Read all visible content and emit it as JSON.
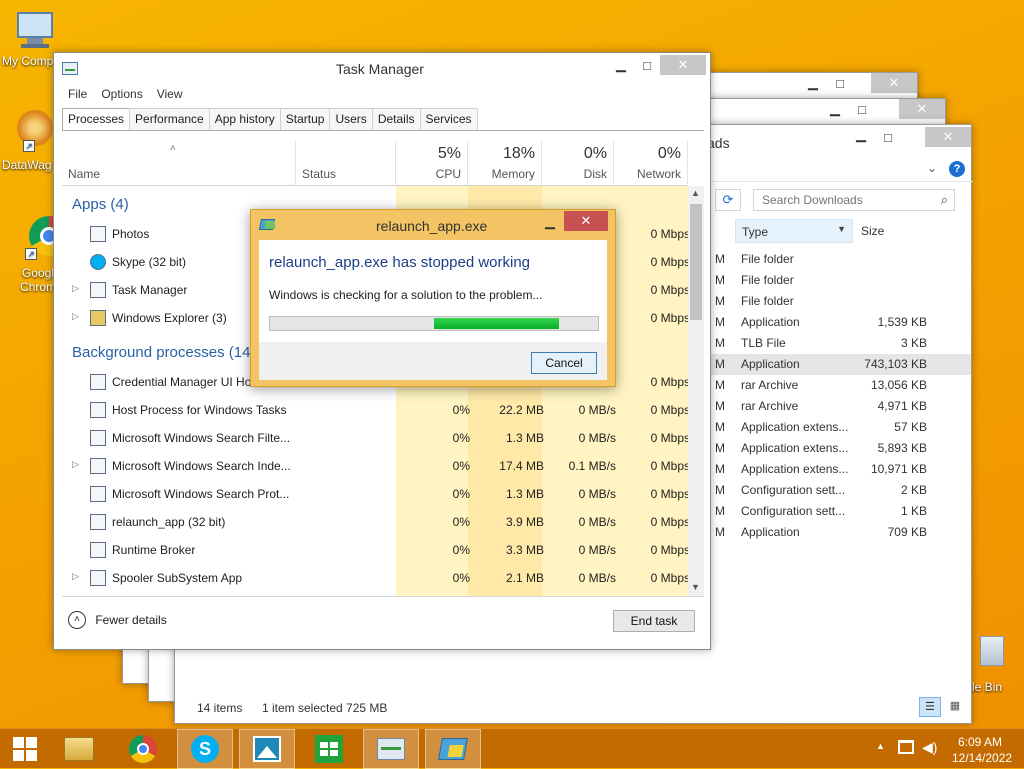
{
  "desktop": {
    "icons": [
      {
        "label": "My Comp",
        "icon": "computer-icon"
      },
      {
        "label": "DataWag",
        "icon": "datawag-icon"
      },
      {
        "label": "Googl Chrom",
        "icon": "chrome-icon"
      },
      {
        "label": "cle Bin",
        "icon": "recycle-bin-icon"
      }
    ]
  },
  "explorer": {
    "title_fragment": "ads",
    "search_placeholder": "Search Downloads",
    "columns": {
      "type": "Type",
      "size": "Size"
    },
    "rows": [
      {
        "prefix": "M",
        "type": "File folder",
        "size": ""
      },
      {
        "prefix": "M",
        "type": "File folder",
        "size": ""
      },
      {
        "prefix": "M",
        "type": "File folder",
        "size": ""
      },
      {
        "prefix": "M",
        "type": "Application",
        "size": "1,539 KB"
      },
      {
        "prefix": "M",
        "type": "TLB File",
        "size": "3 KB"
      },
      {
        "prefix": "M",
        "type": "Application",
        "size": "743,103 KB"
      },
      {
        "prefix": "M",
        "type": "rar Archive",
        "size": "13,056 KB"
      },
      {
        "prefix": "M",
        "type": "rar Archive",
        "size": "4,971 KB"
      },
      {
        "prefix": "M",
        "type": "Application extens...",
        "size": "57 KB"
      },
      {
        "prefix": "M",
        "type": "Application extens...",
        "size": "5,893 KB"
      },
      {
        "prefix": "M",
        "type": "Application extens...",
        "size": "10,971 KB"
      },
      {
        "prefix": "M",
        "type": "Configuration sett...",
        "size": "2 KB"
      },
      {
        "prefix": "M",
        "type": "Configuration sett...",
        "size": "1 KB"
      },
      {
        "prefix": "M",
        "type": "Application",
        "size": "709 KB"
      }
    ],
    "status_items": "14 items",
    "status_selected": "1 item selected  725 MB"
  },
  "task_manager": {
    "title": "Task Manager",
    "menu": [
      "File",
      "Options",
      "View"
    ],
    "tabs": [
      "Processes",
      "Performance",
      "App history",
      "Startup",
      "Users",
      "Details",
      "Services"
    ],
    "columns": {
      "name": "Name",
      "status": "Status",
      "cpu": {
        "pct": "5%",
        "label": "CPU"
      },
      "memory": {
        "pct": "18%",
        "label": "Memory"
      },
      "disk": {
        "pct": "0%",
        "label": "Disk"
      },
      "network": {
        "pct": "0%",
        "label": "Network"
      }
    },
    "apps_group": "Apps (4)",
    "apps": [
      {
        "name": "Photos",
        "network": "0 Mbps",
        "expandable": false
      },
      {
        "name": "Skype (32 bit)",
        "network": "0 Mbps",
        "expandable": false
      },
      {
        "name": "Task Manager",
        "network": "0 Mbps",
        "expandable": true
      },
      {
        "name": "Windows Explorer (3)",
        "network": "0 Mbps",
        "expandable": true
      }
    ],
    "bg_group": "Background processes (14",
    "bg": [
      {
        "name": "Credential Manager UI Hos",
        "cpu": "",
        "memory": "",
        "disk": "",
        "network": "0 Mbps",
        "expandable": false
      },
      {
        "name": "Host Process for Windows Tasks",
        "cpu": "0%",
        "memory": "22.2 MB",
        "disk": "0 MB/s",
        "network": "0 Mbps",
        "expandable": false
      },
      {
        "name": "Microsoft Windows Search Filte...",
        "cpu": "0%",
        "memory": "1.3 MB",
        "disk": "0 MB/s",
        "network": "0 Mbps",
        "expandable": false
      },
      {
        "name": "Microsoft Windows Search Inde...",
        "cpu": "0%",
        "memory": "17.4 MB",
        "disk": "0.1 MB/s",
        "network": "0 Mbps",
        "expandable": true
      },
      {
        "name": "Microsoft Windows Search Prot...",
        "cpu": "0%",
        "memory": "1.3 MB",
        "disk": "0 MB/s",
        "network": "0 Mbps",
        "expandable": false
      },
      {
        "name": "relaunch_app (32 bit)",
        "cpu": "0%",
        "memory": "3.9 MB",
        "disk": "0 MB/s",
        "network": "0 Mbps",
        "expandable": false
      },
      {
        "name": "Runtime Broker",
        "cpu": "0%",
        "memory": "3.3 MB",
        "disk": "0 MB/s",
        "network": "0 Mbps",
        "expandable": false
      },
      {
        "name": "Spooler SubSystem App",
        "cpu": "0%",
        "memory": "2.1 MB",
        "disk": "0 MB/s",
        "network": "0 Mbps",
        "expandable": true
      }
    ],
    "fewer_details": "Fewer details",
    "end_task": "End task"
  },
  "dialog": {
    "title": "relaunch_app.exe",
    "heading": "relaunch_app.exe has stopped working",
    "message": "Windows is checking for a solution to the problem...",
    "progress": 0.38,
    "cancel": "Cancel"
  },
  "taskbar": {
    "items": [
      "file-explorer-icon",
      "chrome-icon",
      "skype-icon",
      "photos-icon",
      "store-icon",
      "task-manager-icon",
      "relaunch-app-icon"
    ],
    "time": "6:09 AM",
    "date": "12/14/2022"
  },
  "colors": {
    "desktop": "#f4a300",
    "taskbar": "#c36a00",
    "accent_blue": "#2b5fa6",
    "progress": "#06b025",
    "close_red": "#c75050"
  }
}
